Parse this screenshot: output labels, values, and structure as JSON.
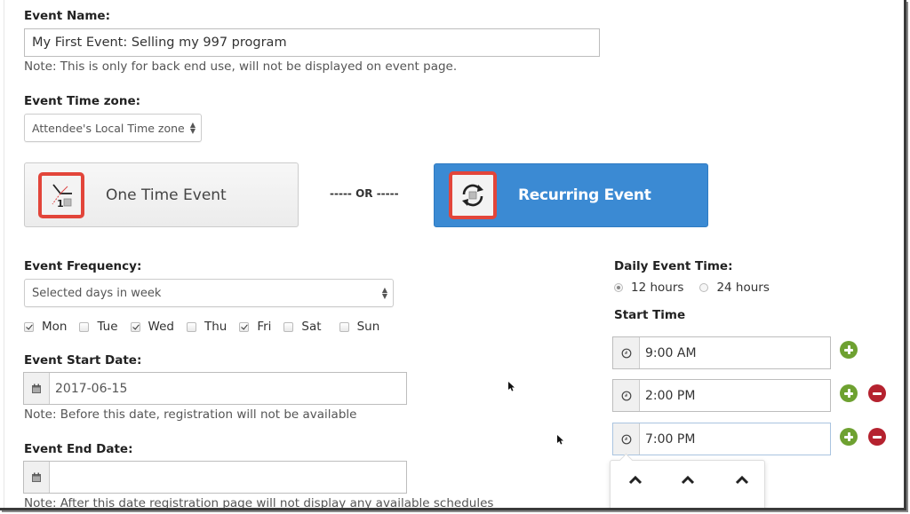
{
  "event_name": {
    "label": "Event Name:",
    "value": "My First Event: Selling my 997 program",
    "note": "Note: This is only for back end use, will not be displayed on event page."
  },
  "time_zone": {
    "label": "Event Time zone:",
    "selected": "Attendee's Local Time zone"
  },
  "event_type": {
    "one_time_label": "One Time Event",
    "separator": "----- OR -----",
    "recurring_label": "Recurring Event",
    "selected": "Recurring Event",
    "accent_color": "#3b8ad3",
    "icon_border_color": "#e2453a"
  },
  "frequency": {
    "label": "Event Frequency:",
    "selected": "Selected days in week",
    "days": [
      {
        "label": "Mon",
        "checked": true
      },
      {
        "label": "Tue",
        "checked": false
      },
      {
        "label": "Wed",
        "checked": true
      },
      {
        "label": "Thu",
        "checked": false
      },
      {
        "label": "Fri",
        "checked": true
      },
      {
        "label": "Sat",
        "checked": false
      },
      {
        "label": "Sun",
        "checked": false
      }
    ]
  },
  "start_date": {
    "label": "Event Start Date:",
    "value": "2017-06-15",
    "note": "Note: Before this date, registration will not be available"
  },
  "end_date": {
    "label": "Event End Date:",
    "value": "",
    "note": "Note: After this date registration page will not display any available schedules"
  },
  "daily_time": {
    "label": "Daily Event Time:",
    "options": [
      {
        "label": "12 hours",
        "selected": true
      },
      {
        "label": "24 hours",
        "selected": false
      }
    ]
  },
  "start_time": {
    "label": "Start Time",
    "times": [
      "9:00 AM",
      "2:00 PM",
      "7:00 PM"
    ],
    "add_color": "#6ea131",
    "remove_color": "#b5222f"
  },
  "time_picker": {
    "controls": [
      "increment-hour",
      "increment-minute",
      "increment-period"
    ]
  }
}
